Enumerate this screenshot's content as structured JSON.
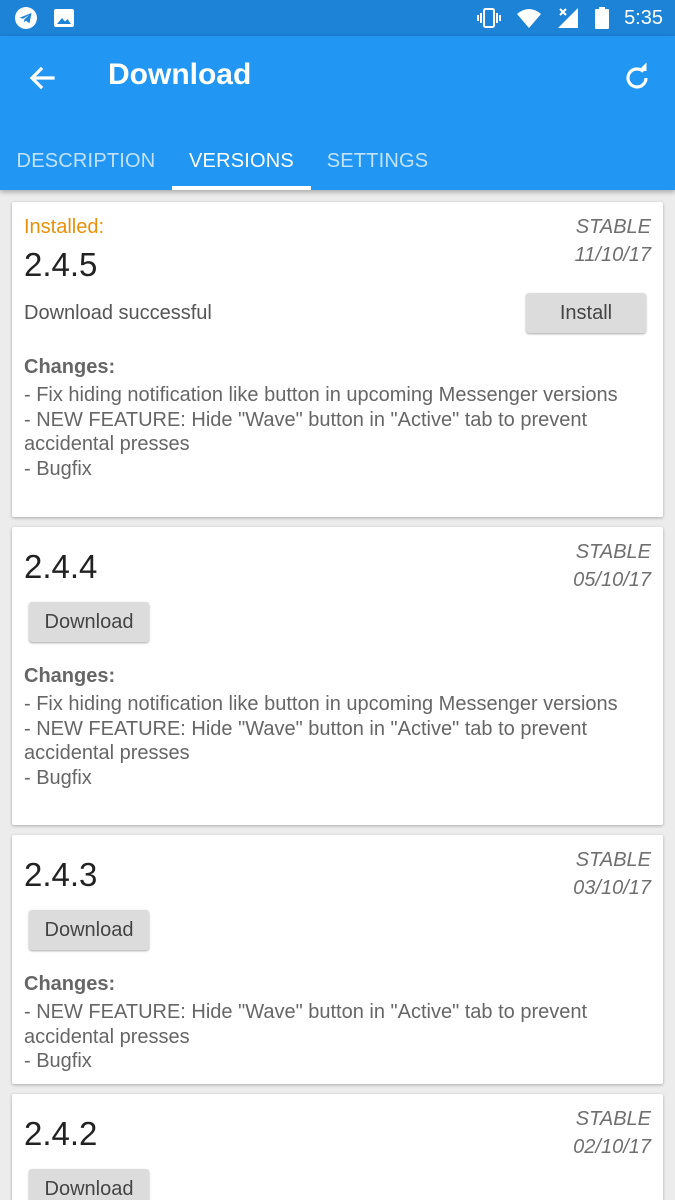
{
  "status_bar": {
    "time": "5:35",
    "icons": [
      "telegram-icon",
      "image-icon",
      "vibrate-icon",
      "wifi-icon",
      "signal-icon",
      "battery-icon"
    ]
  },
  "app_bar": {
    "title": "Download",
    "back_icon": "arrow-back-icon",
    "refresh_icon": "refresh-icon"
  },
  "tabs": [
    {
      "label": "DESCRIPTION",
      "active": false
    },
    {
      "label": "VERSIONS",
      "active": true
    },
    {
      "label": "SETTINGS",
      "active": false
    }
  ],
  "colors": {
    "primary": "#2196f3",
    "status_bar": "#1c83d7",
    "installed": "#e8900c"
  },
  "versions": [
    {
      "installed_label": "Installed:",
      "version": "2.4.5",
      "channel": "STABLE",
      "date": "11/10/17",
      "status": "Download successful",
      "button": "Install",
      "changes_title": "Changes:",
      "changes": [
        "- Fix hiding notification like button in upcoming Messenger versions",
        "- NEW FEATURE: Hide \"Wave\" button in \"Active\" tab to prevent accidental presses",
        "- Bugfix"
      ]
    },
    {
      "version": "2.4.4",
      "channel": "STABLE",
      "date": "05/10/17",
      "button": "Download",
      "changes_title": "Changes:",
      "changes": [
        "- Fix hiding notification like button in upcoming Messenger versions",
        "- NEW FEATURE: Hide \"Wave\" button in \"Active\" tab to prevent accidental presses",
        "- Bugfix"
      ]
    },
    {
      "version": "2.4.3",
      "channel": "STABLE",
      "date": "03/10/17",
      "button": "Download",
      "changes_title": "Changes:",
      "changes": [
        "- NEW FEATURE: Hide \"Wave\" button in \"Active\" tab to prevent accidental presses",
        "- Bugfix"
      ]
    },
    {
      "version": "2.4.2",
      "channel": "STABLE",
      "date": "02/10/17",
      "button": "Download"
    }
  ]
}
